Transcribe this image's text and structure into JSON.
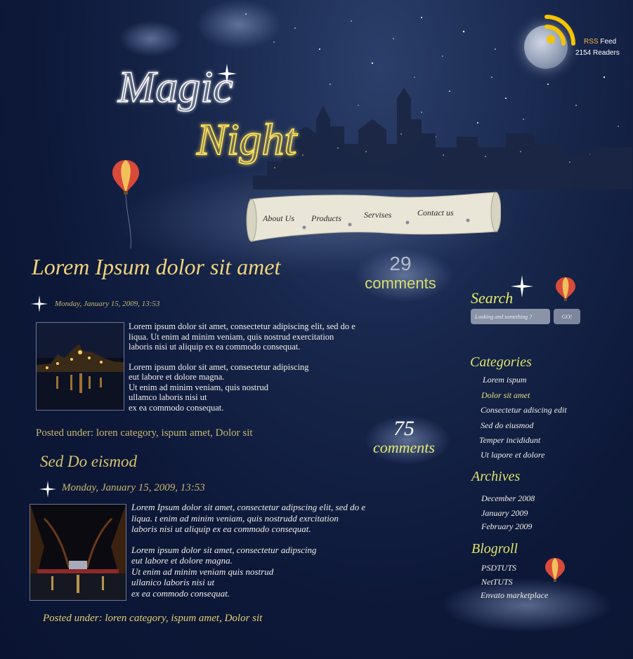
{
  "header": {
    "logo_line1": "Magic",
    "logo_line2": "Night",
    "rss_label_highlight": "RSS",
    "rss_label": "Feed",
    "readers": "2154 Readers"
  },
  "nav": {
    "items": [
      "About Us",
      "Products",
      "Servises",
      "Contact us"
    ]
  },
  "posts": [
    {
      "title": "Lorem Ipsum dolor sit amet",
      "comments_count": "29",
      "comments_label": "comments",
      "date": "Monday, January 15, 2009, 13:53",
      "para1": "Lorem ipsum dolor sit amet, consectetur adipiscing elit, sed do e\nliqua. Ut enim ad minim veniam, quis nostrud exercitation\nlaboris nisi ut aliquip ex ea commodo consequat.",
      "para2": "Lorem ipsum dolor sit amet, consectetur adipiscing\neut labore et dolore magna.\nUt enim ad minim veniam, quis nostrud\nullamco laboris nisi ut\nex ea commodo consequat.",
      "posted_under": "Posted under: loren category, ispum amet, Dolor sit"
    },
    {
      "title": "Sed Do eismod",
      "comments_count": "75",
      "comments_label": "comments",
      "date": "Monday, January 15, 2009, 13:53",
      "para1": "Lorem Ipsum dolor sit amet, consectetur adipscing elit, sed do e\nliqua. t enim ad minim veniam,  quis nostrudd exrcitation\nlaboris nisi ut aliquip ex ea commodo consequat.",
      "para2": "Lorem ipsum dolor sit amet, consectetur adipscing\neut labore et dolore magna.\nUt enim ad minim veniam quis nostrud\nullanico laboris nisi ut\nex ea commodo consequat.",
      "posted_under": "Posted under: loren category, ispum amet, Dolor sit"
    }
  ],
  "sidebar": {
    "search_title": "Search",
    "search_placeholder": "Looking and something ?",
    "search_button": "GO!",
    "categories_title": "Categories",
    "categories": [
      "Lorem ispum",
      "Dolor sit amet",
      "Consectetur adiscing edit",
      "Sed do eiusmod",
      "Temper incididunt",
      "Ut  lapore et dolore"
    ],
    "archives_title": "Archives",
    "archives": [
      "December 2008",
      "January 2009",
      "February 2009"
    ],
    "blogroll_title": "Blogroll",
    "blogroll": [
      "PSDTUTS",
      "NetTUTS",
      "Envato marketplace"
    ]
  },
  "colors": {
    "title_gold": "#f1d47a",
    "sidebar_heading": "#dfe46b",
    "rss_orange": "#f2b64a"
  }
}
